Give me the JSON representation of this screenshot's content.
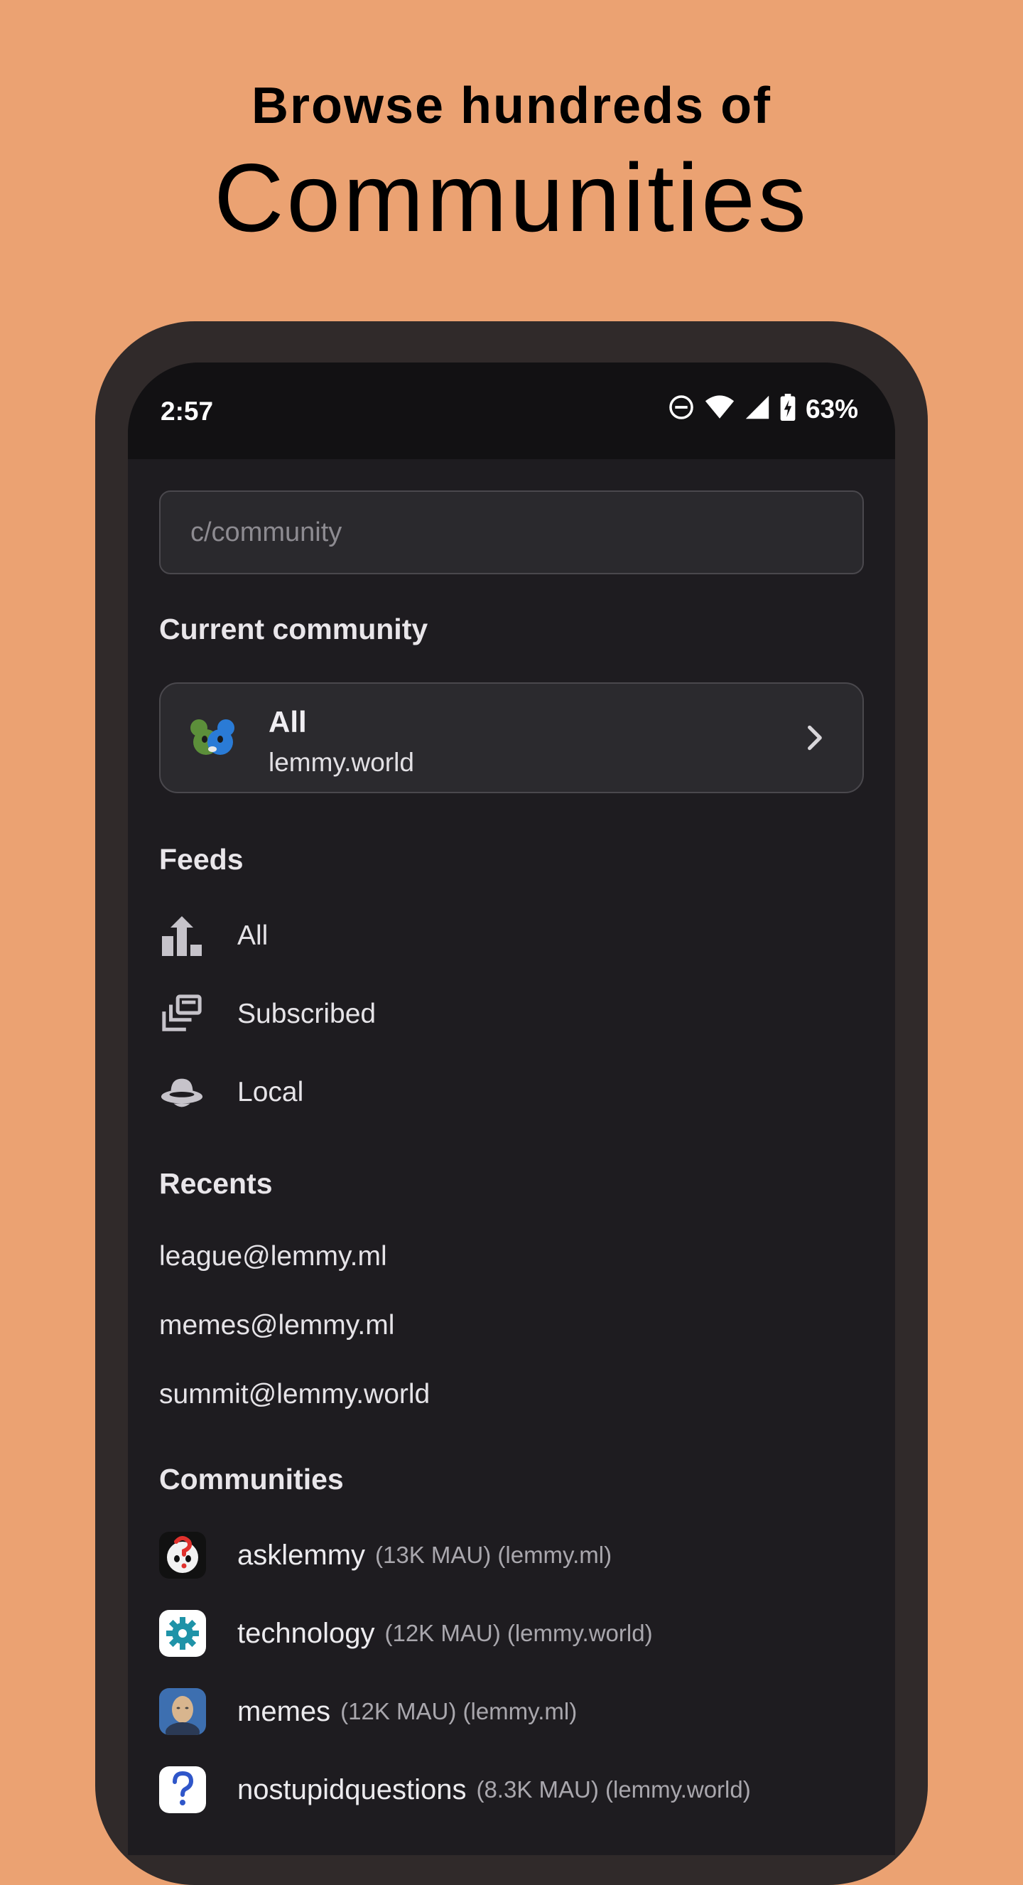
{
  "hero": {
    "line1": "Browse hundreds of",
    "line2": "Communities"
  },
  "status_bar": {
    "time": "2:57",
    "battery": "63%",
    "icons": [
      "do-not-disturb-icon",
      "wifi-icon",
      "cell-signal-icon",
      "battery-charging-icon"
    ]
  },
  "search": {
    "placeholder": "c/community"
  },
  "current_community": {
    "section_title": "Current community",
    "title": "All",
    "instance": "lemmy.world"
  },
  "feeds": {
    "section_title": "Feeds",
    "items": [
      {
        "label": "All",
        "icon": "trending-bars-icon"
      },
      {
        "label": "Subscribed",
        "icon": "stacked-cards-icon"
      },
      {
        "label": "Local",
        "icon": "ufo-icon"
      }
    ]
  },
  "recents": {
    "section_title": "Recents",
    "items": [
      "league@lemmy.ml",
      "memes@lemmy.ml",
      "summit@lemmy.world"
    ]
  },
  "communities": {
    "section_title": "Communities",
    "items": [
      {
        "name": "asklemmy",
        "meta": "(13K MAU) (lemmy.ml)"
      },
      {
        "name": "technology",
        "meta": "(12K MAU) (lemmy.world)"
      },
      {
        "name": "memes",
        "meta": "(12K MAU) (lemmy.ml)"
      },
      {
        "name": "nostupidquestions",
        "meta": "(8.3K MAU) (lemmy.world)"
      }
    ]
  },
  "colors": {
    "background": "#eba272",
    "frame": "#302a2a",
    "screen": "#1e1c20",
    "status_bar": "#121113"
  }
}
